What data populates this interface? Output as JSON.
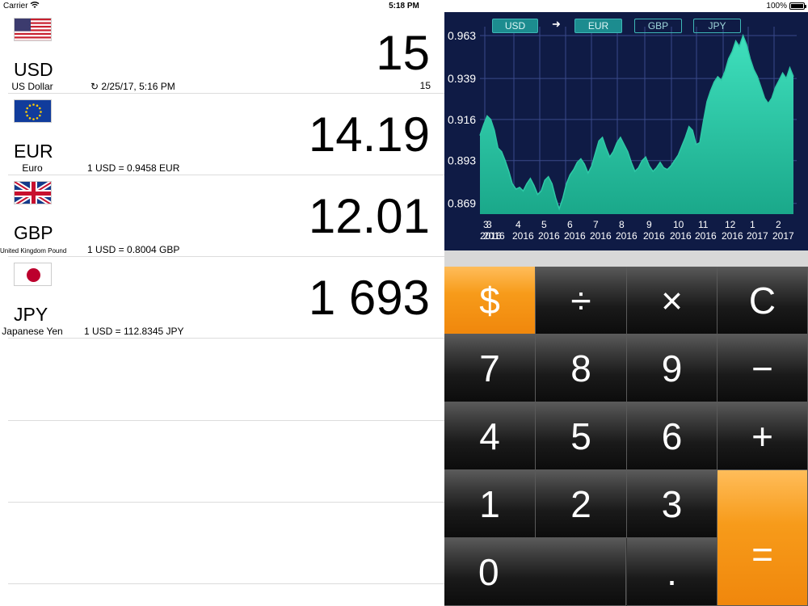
{
  "status_bar": {
    "carrier": "Carrier",
    "time": "5:18 PM",
    "battery": "100%"
  },
  "currencies": [
    {
      "code": "USD",
      "name": "US Dollar",
      "info": "↻ 2/25/17, 5:16 PM",
      "value": "15",
      "value_sub": "15",
      "flag": "us-flag"
    },
    {
      "code": "EUR",
      "name": "Euro",
      "info": "1 USD = 0.9458 EUR",
      "value": "14.19",
      "flag": "eu-flag"
    },
    {
      "code": "GBP",
      "name": "United Kingdom Pound",
      "info": "1 USD = 0.8004 GBP",
      "value": "12.01",
      "flag": "uk-flag"
    },
    {
      "code": "JPY",
      "name": "Japanese Yen",
      "info": "1 USD = 112.8345 JPY",
      "value": "1 693",
      "flag": "jp-flag"
    }
  ],
  "chart": {
    "buttons": [
      "USD",
      "EUR",
      "GBP",
      "JPY"
    ],
    "arrow": "➜",
    "active": [
      "USD",
      "EUR"
    ],
    "accent": "#2ec9a7",
    "background": "#0f1b45"
  },
  "chart_data": {
    "type": "area",
    "title": "",
    "xlabel": "",
    "ylabel": "",
    "y_ticks": [
      "0.963",
      "0.939",
      "0.916",
      "0.893",
      "0.869"
    ],
    "x_ticks": [
      {
        "month": "3",
        "year": "2016"
      },
      {
        "month": "3",
        "year": "2016"
      },
      {
        "month": "4",
        "year": "2016"
      },
      {
        "month": "5",
        "year": "2016"
      },
      {
        "month": "6",
        "year": "2016"
      },
      {
        "month": "7",
        "year": "2016"
      },
      {
        "month": "8",
        "year": "2016"
      },
      {
        "month": "9",
        "year": "2016"
      },
      {
        "month": "10",
        "year": "2016"
      },
      {
        "month": "11",
        "year": "2016"
      },
      {
        "month": "12",
        "year": "2016"
      },
      {
        "month": "1",
        "year": "2017"
      },
      {
        "month": "2",
        "year": "2017"
      }
    ],
    "ylim": [
      0.863,
      0.968
    ],
    "values": [
      0.907,
      0.913,
      0.918,
      0.916,
      0.91,
      0.9,
      0.898,
      0.893,
      0.887,
      0.88,
      0.877,
      0.878,
      0.876,
      0.88,
      0.883,
      0.879,
      0.874,
      0.876,
      0.882,
      0.884,
      0.88,
      0.872,
      0.866,
      0.872,
      0.88,
      0.885,
      0.888,
      0.892,
      0.894,
      0.891,
      0.886,
      0.89,
      0.897,
      0.904,
      0.906,
      0.9,
      0.895,
      0.898,
      0.903,
      0.906,
      0.902,
      0.898,
      0.892,
      0.887,
      0.889,
      0.893,
      0.895,
      0.89,
      0.887,
      0.889,
      0.892,
      0.889,
      0.888,
      0.89,
      0.893,
      0.896,
      0.901,
      0.906,
      0.912,
      0.91,
      0.902,
      0.903,
      0.915,
      0.926,
      0.932,
      0.937,
      0.94,
      0.938,
      0.943,
      0.95,
      0.954,
      0.96,
      0.957,
      0.963,
      0.958,
      0.95,
      0.944,
      0.94,
      0.934,
      0.928,
      0.925,
      0.928,
      0.934,
      0.938,
      0.942,
      0.939,
      0.945,
      0.94
    ],
    "grid": true
  },
  "keypad": {
    "keys": [
      "$",
      "÷",
      "×",
      "C",
      "7",
      "8",
      "9",
      "−",
      "4",
      "5",
      "6",
      "+",
      "1",
      "2",
      "3",
      "=",
      "0",
      "."
    ]
  }
}
